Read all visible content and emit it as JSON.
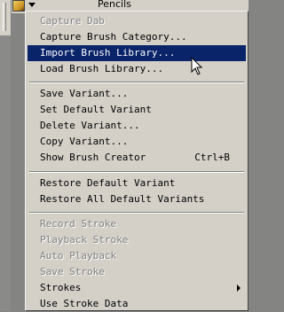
{
  "toolbar": {
    "category": "Pencils"
  },
  "menu": {
    "items": [
      {
        "label": "Capture Dab",
        "disabled": true
      },
      {
        "label": "Capture Brush Category...",
        "disabled": false
      },
      {
        "label": "Import Brush Library...",
        "disabled": false,
        "selected": true
      },
      {
        "label": "Load Brush Library...",
        "disabled": false
      },
      {
        "label": "Save Variant...",
        "disabled": false
      },
      {
        "label": "Set Default Variant",
        "disabled": false
      },
      {
        "label": "Delete Variant...",
        "disabled": false
      },
      {
        "label": "Copy Variant...",
        "disabled": false
      },
      {
        "label": "Show Brush Creator",
        "disabled": false,
        "shortcut": "Ctrl+B"
      },
      {
        "label": "Restore Default Variant",
        "disabled": false
      },
      {
        "label": "Restore All Default Variants",
        "disabled": false
      },
      {
        "label": "Record Stroke",
        "disabled": true
      },
      {
        "label": "Playback Stroke",
        "disabled": true
      },
      {
        "label": "Auto Playback",
        "disabled": true
      },
      {
        "label": "Save Stroke",
        "disabled": true
      },
      {
        "label": "Strokes",
        "disabled": false,
        "submenu": true
      },
      {
        "label": "Use Stroke Data",
        "disabled": false
      }
    ]
  },
  "colors": {
    "selection": "#0a246a",
    "menu_bg": "#d4d0c8",
    "disabled_text": "#808080"
  },
  "icons": [
    "brush-thumbnail-icon",
    "dropdown-arrow-icon",
    "submenu-arrow-icon",
    "mouse-cursor-icon"
  ]
}
